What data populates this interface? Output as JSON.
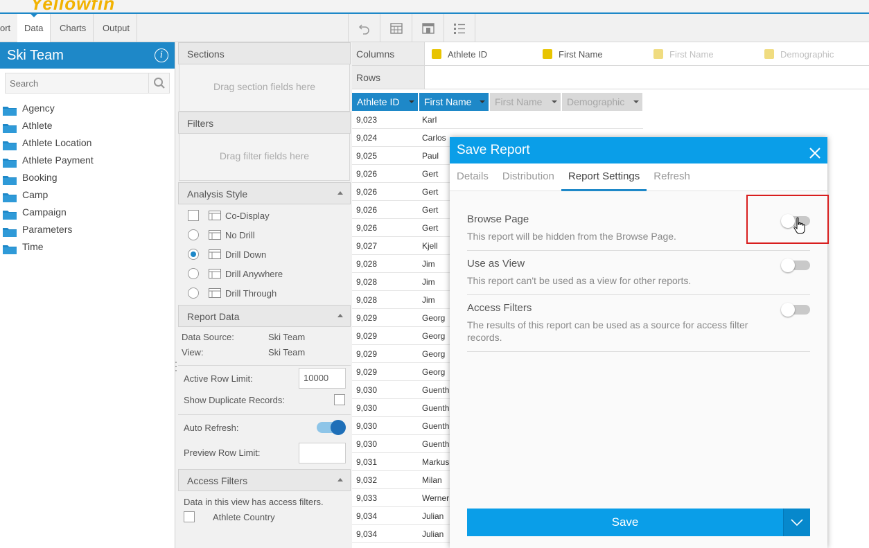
{
  "header": {
    "logo_text": "Yellowfin"
  },
  "nav": {
    "tabs": [
      {
        "label": "ort"
      },
      {
        "label": "Data"
      },
      {
        "label": "Charts"
      },
      {
        "label": "Output"
      }
    ],
    "toolbar_icons": [
      "undo-icon",
      "table-icon",
      "layout-icon",
      "list-icon"
    ]
  },
  "left": {
    "title": "Ski Team",
    "search_placeholder": "Search",
    "folders": [
      "Agency",
      "Athlete",
      "Athlete Location",
      "Athlete Payment",
      "Booking",
      "Camp",
      "Campaign",
      "Parameters",
      "Time"
    ]
  },
  "middle": {
    "sections": {
      "title": "Sections",
      "drop_text": "Drag section fields here"
    },
    "filters": {
      "title": "Filters",
      "drop_text": "Drag filter fields here"
    },
    "analysis": {
      "title": "Analysis Style",
      "options": [
        {
          "label": "Co-Display",
          "kind": "checkbox",
          "selected": false
        },
        {
          "label": "No Drill",
          "kind": "radio",
          "selected": false
        },
        {
          "label": "Drill Down",
          "kind": "radio",
          "selected": true
        },
        {
          "label": "Drill Anywhere",
          "kind": "radio",
          "selected": false
        },
        {
          "label": "Drill Through",
          "kind": "radio",
          "selected": false
        }
      ]
    },
    "report_data": {
      "title": "Report Data",
      "data_source_label": "Data Source:",
      "data_source_value": "Ski Team",
      "view_label": "View:",
      "view_value": "Ski Team",
      "row_limit_label": "Active Row Limit:",
      "row_limit_value": "10000",
      "dup_label": "Show Duplicate Records:",
      "auto_refresh_label": "Auto Refresh:",
      "preview_label": "Preview Row Limit:"
    },
    "access_filters": {
      "title": "Access Filters",
      "note": "Data in this view has access filters.",
      "item": "Athlete Country"
    }
  },
  "right": {
    "columns_label": "Columns",
    "rows_label": "Rows",
    "column_chips": [
      {
        "label": "Athlete ID",
        "color": "#e8c400",
        "faded": false
      },
      {
        "label": "First Name",
        "color": "#e8c400",
        "faded": false
      },
      {
        "label": "First Name",
        "color": "#f0dc80",
        "faded": true
      },
      {
        "label": "Demographic",
        "color": "#f0dc80",
        "faded": true
      }
    ],
    "table_headers": [
      "Athlete ID",
      "First Name",
      "First Name",
      "Demographic"
    ],
    "rows": [
      [
        "9,023",
        "Karl"
      ],
      [
        "9,024",
        "Carlos"
      ],
      [
        "9,025",
        "Paul"
      ],
      [
        "9,026",
        "Gert"
      ],
      [
        "9,026",
        "Gert"
      ],
      [
        "9,026",
        "Gert"
      ],
      [
        "9,026",
        "Gert"
      ],
      [
        "9,027",
        "Kjell"
      ],
      [
        "9,028",
        "Jim"
      ],
      [
        "9,028",
        "Jim"
      ],
      [
        "9,028",
        "Jim"
      ],
      [
        "9,029",
        "Georg"
      ],
      [
        "9,029",
        "Georg"
      ],
      [
        "9,029",
        "Georg"
      ],
      [
        "9,029",
        "Georg"
      ],
      [
        "9,030",
        "Guenth"
      ],
      [
        "9,030",
        "Guenth"
      ],
      [
        "9,030",
        "Guenth"
      ],
      [
        "9,030",
        "Guenth"
      ],
      [
        "9,031",
        "Markus"
      ],
      [
        "9,032",
        "Milan"
      ],
      [
        "9,033",
        "Werner"
      ],
      [
        "9,034",
        "Julian"
      ],
      [
        "9,034",
        "Julian"
      ]
    ]
  },
  "modal": {
    "title": "Save Report",
    "tabs": [
      "Details",
      "Distribution",
      "Report Settings",
      "Refresh"
    ],
    "active_tab": 2,
    "settings": [
      {
        "title": "Browse Page",
        "desc": "This report will be hidden from the Browse Page."
      },
      {
        "title": "Use as View",
        "desc": "This report can't be used as a view for other reports."
      },
      {
        "title": "Access Filters",
        "desc": "The results of this report can be used as a source for access filter records."
      }
    ],
    "save_label": "Save"
  },
  "colors": {
    "accent": "#1e88c8",
    "modal_header": "#0a9ee8",
    "highlight": "#d81e1e"
  }
}
